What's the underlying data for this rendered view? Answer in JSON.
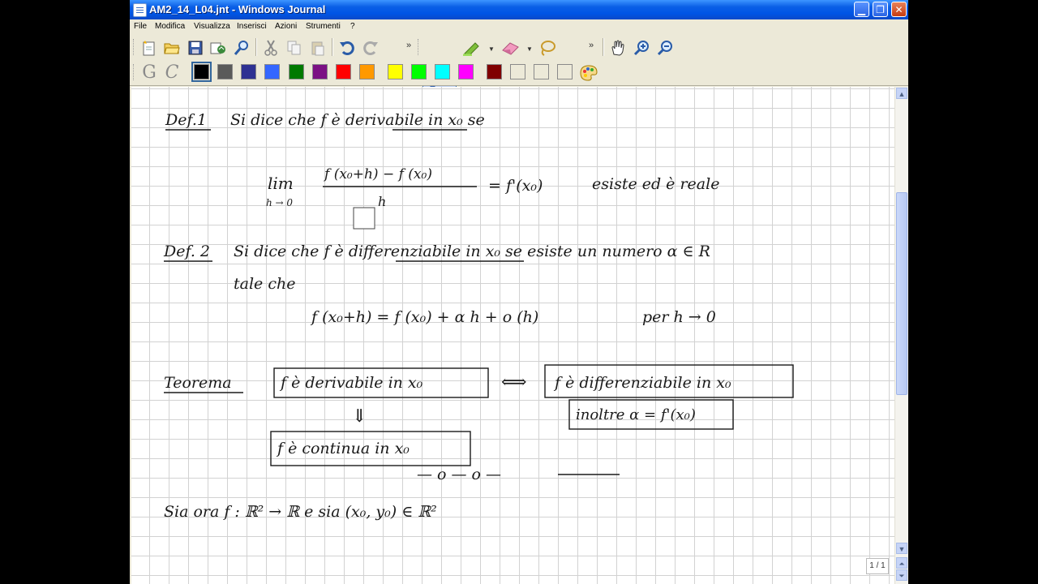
{
  "window": {
    "title": "AM2_14_L04.jnt - Windows Journal",
    "controls": [
      "minimize",
      "maximize",
      "close"
    ]
  },
  "menu": [
    "File",
    "Modifica",
    "Visualizza",
    "Inserisci",
    "Azioni",
    "Strumenti",
    "?"
  ],
  "toolbar1": {
    "icons": [
      "new-page-icon",
      "open-icon",
      "save-icon",
      "email-icon",
      "find-icon",
      "cut-icon",
      "copy-icon",
      "paste-icon",
      "undo-icon",
      "redo-icon",
      "pen-icon",
      "highlighter-icon",
      "eraser-icon",
      "lasso-icon",
      "hand-icon",
      "zoom-in-icon",
      "zoom-out-icon"
    ],
    "overflow": "»"
  },
  "toolbar2": {
    "format_icons": [
      "G",
      "C"
    ],
    "colors": [
      "#000000",
      "#5a5a5a",
      "#2e3192",
      "#3366ff",
      "#007a00",
      "#7b1184",
      "#ff0000",
      "#ff9900",
      "#ffff00",
      "#00ff00",
      "#00ffff",
      "#ff00ff",
      "#800000",
      "#ece9d8",
      "#ece9d8",
      "#ece9d8"
    ],
    "selected_color": "#000000"
  },
  "notes": {
    "def1_label": "Def.1",
    "def1_text": "Si dice che f è derivabile in x₀ se",
    "limit_lim": "lim",
    "limit_sub": "h → 0",
    "limit_numerator": "f (x₀+h) − f (x₀)",
    "limit_denominator": "h",
    "limit_rhs": "= f'(x₀)",
    "limit_tail": "esiste ed è reale",
    "def2_label": "Def. 2",
    "def2_text": "Si dice che f è differenziabile in x₀ se esiste un numero α ∈ R",
    "def2_line2": "tale che",
    "def2_formula": "f (x₀+h) = f (x₀) + α h + o (h)",
    "def2_tail": "per h → 0",
    "teorema_label": "Teorema",
    "box1": "f è derivabile in x₀",
    "equiv": "⟺",
    "box2": "f è differenziabile in x₀",
    "box3": "inoltre α = f'(x₀)",
    "implies": "⇓",
    "box4": "f è continua in x₀",
    "divider": "— o — o —",
    "last_line": "Sia ora  f : ℝ² → ℝ   e  sia  (x₀, y₀) ∈ ℝ²"
  },
  "page_indicator": "1 / 1"
}
